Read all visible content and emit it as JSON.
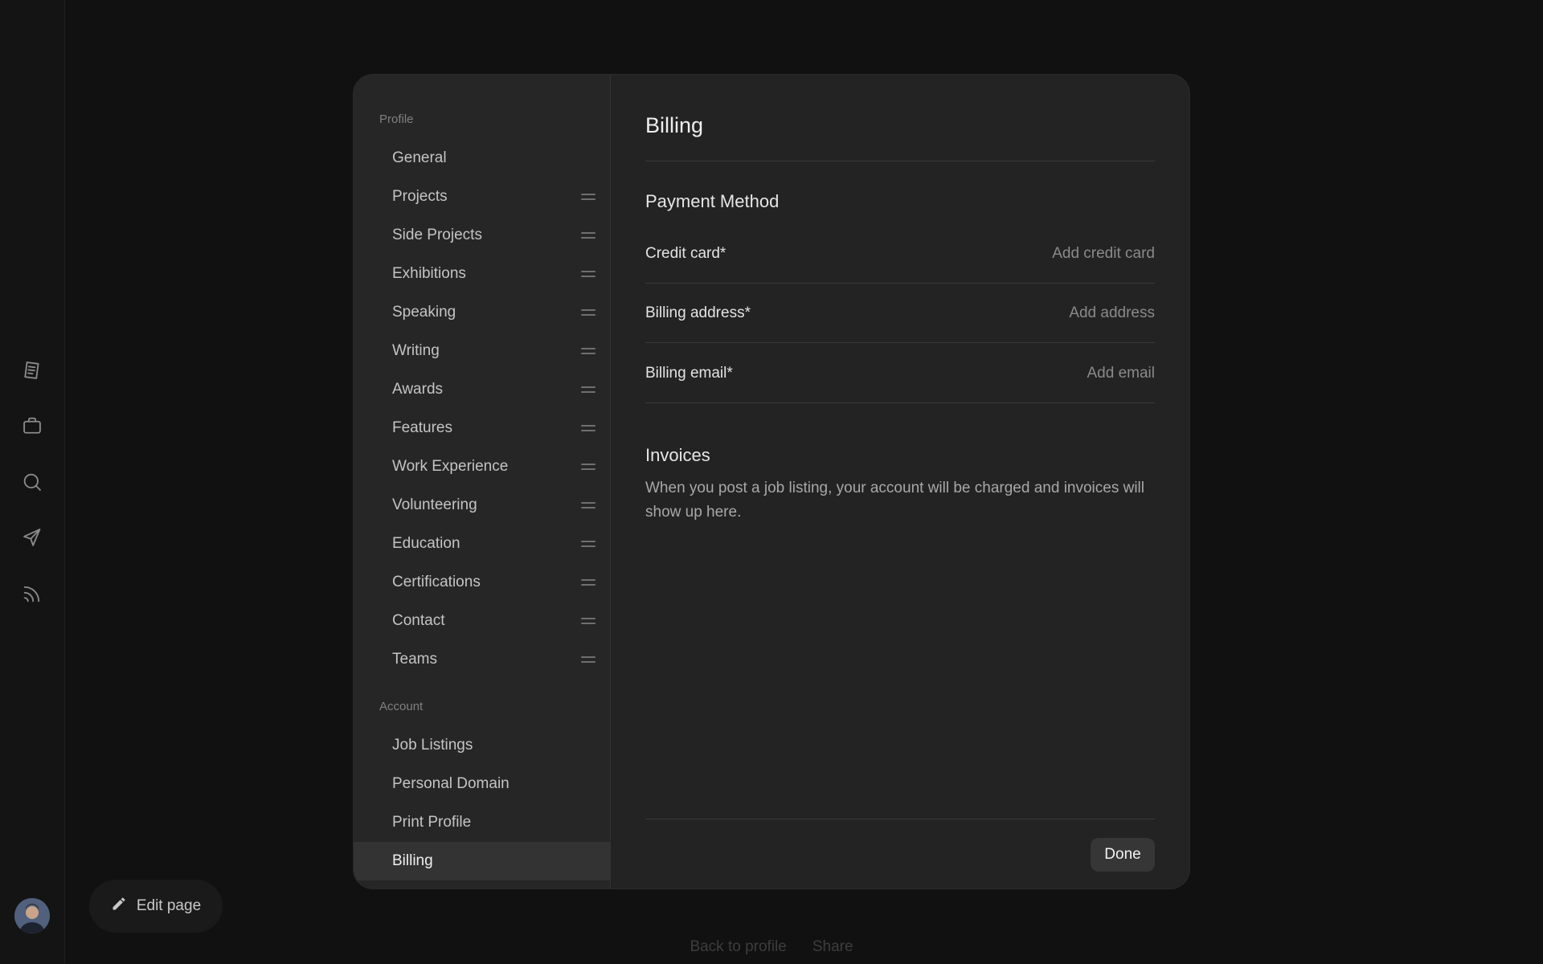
{
  "sidebar_profile_label": "Profile",
  "sidebar_account_label": "Account",
  "profile_items": [
    {
      "label": "General"
    },
    {
      "label": "Projects"
    },
    {
      "label": "Side Projects"
    },
    {
      "label": "Exhibitions"
    },
    {
      "label": "Speaking"
    },
    {
      "label": "Writing"
    },
    {
      "label": "Awards"
    },
    {
      "label": "Features"
    },
    {
      "label": "Work Experience"
    },
    {
      "label": "Volunteering"
    },
    {
      "label": "Education"
    },
    {
      "label": "Certifications"
    },
    {
      "label": "Contact"
    },
    {
      "label": "Teams"
    }
  ],
  "account_items": [
    {
      "label": "Job Listings"
    },
    {
      "label": "Personal Domain"
    },
    {
      "label": "Print Profile"
    },
    {
      "label": "Billing"
    }
  ],
  "content": {
    "title": "Billing",
    "payment_heading": "Payment Method",
    "fields": [
      {
        "label": "Credit card*",
        "action": "Add credit card"
      },
      {
        "label": "Billing address*",
        "action": "Add address"
      },
      {
        "label": "Billing email*",
        "action": "Add email"
      }
    ],
    "invoices_heading": "Invoices",
    "invoices_text": "When you post a job listing, your account will be charged and invoices will show up here.",
    "done_label": "Done"
  },
  "edit_page_label": "Edit page",
  "footer": {
    "back_label": "Back to profile",
    "share_label": "Share"
  },
  "rail_icons": [
    "document-icon",
    "briefcase-icon",
    "search-icon",
    "send-icon",
    "rss-icon"
  ]
}
